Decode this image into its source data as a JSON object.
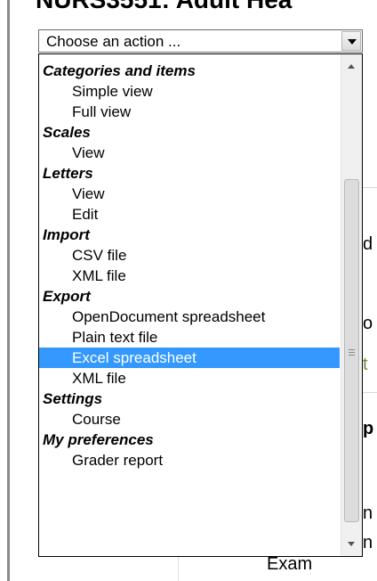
{
  "page": {
    "heading": "NURS3551: Adult Hea"
  },
  "select": {
    "value": "Choose an action ..."
  },
  "background": {
    "fragments": [
      "d",
      "o",
      "t",
      "p",
      "n",
      "n",
      "Exam"
    ]
  },
  "dropdown": {
    "groups": [
      {
        "label": "Categories and items",
        "options": [
          {
            "label": "Simple view"
          },
          {
            "label": "Full view"
          }
        ]
      },
      {
        "label": "Scales",
        "options": [
          {
            "label": "View"
          }
        ]
      },
      {
        "label": "Letters",
        "options": [
          {
            "label": "View"
          },
          {
            "label": "Edit"
          }
        ]
      },
      {
        "label": "Import",
        "options": [
          {
            "label": "CSV file"
          },
          {
            "label": "XML file"
          }
        ]
      },
      {
        "label": "Export",
        "options": [
          {
            "label": "OpenDocument spreadsheet"
          },
          {
            "label": "Plain text file"
          },
          {
            "label": "Excel spreadsheet",
            "selected": true
          },
          {
            "label": "XML file"
          }
        ]
      },
      {
        "label": "Settings",
        "options": [
          {
            "label": "Course"
          }
        ]
      },
      {
        "label": "My preferences",
        "options": [
          {
            "label": "Grader report"
          }
        ]
      }
    ]
  },
  "colors": {
    "selection": "#3399ff"
  }
}
